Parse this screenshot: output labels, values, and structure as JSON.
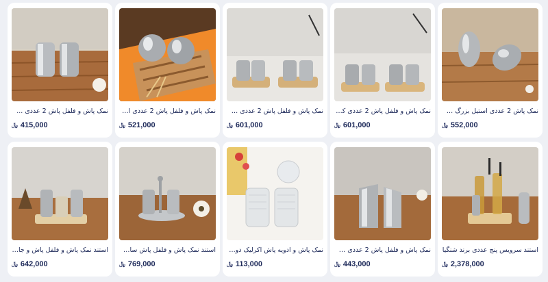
{
  "currency_icon": "﷼",
  "products": [
    {
      "title": "نمک پاش و فلفل پاش 2 عددی ...",
      "price": "415,000",
      "image": "two-cylinder-shakers-wood-table"
    },
    {
      "title": "نمک پاش و فلفل پاش 2 عددی استی...",
      "price": "521,000",
      "image": "two-sphere-shakers-orange-mat"
    },
    {
      "title": "نمک پاش و فلفل پاش 2 عددی سرک ...",
      "price": "601,000",
      "image": "two-shaker-sets-wood-trays"
    },
    {
      "title": "نمک پاش و فلفل پاش 2 عددی کمر...",
      "price": "601,000",
      "image": "two-shaker-sets-wood-trays"
    },
    {
      "title": "نمک پاش 2 عددی استیل بزرگ طرح...",
      "price": "552,000",
      "image": "two-egg-shaped-shakers"
    },
    {
      "title": "استند نمک پاش و فلفل پاش و جای ...",
      "price": "642,000",
      "image": "shaker-stand-with-toothpick-holder"
    },
    {
      "title": "استند نمک پاش و فلفل پاش سات و...",
      "price": "769,000",
      "image": "shaker-set-on-steel-tray"
    },
    {
      "title": "نمک پاش و ادویه پاش اکرلیک دوب...",
      "price": "113,000",
      "image": "acrylic-spice-jars"
    },
    {
      "title": "نمک پاش و فلفل پاش 2 عددی سرک ...",
      "price": "443,000",
      "image": "two-slanted-steel-shakers"
    },
    {
      "title": "استند سرویس پنج عددی برند شنگیا",
      "price": "2,378,000",
      "image": "five-piece-oil-cruet-stand"
    }
  ]
}
